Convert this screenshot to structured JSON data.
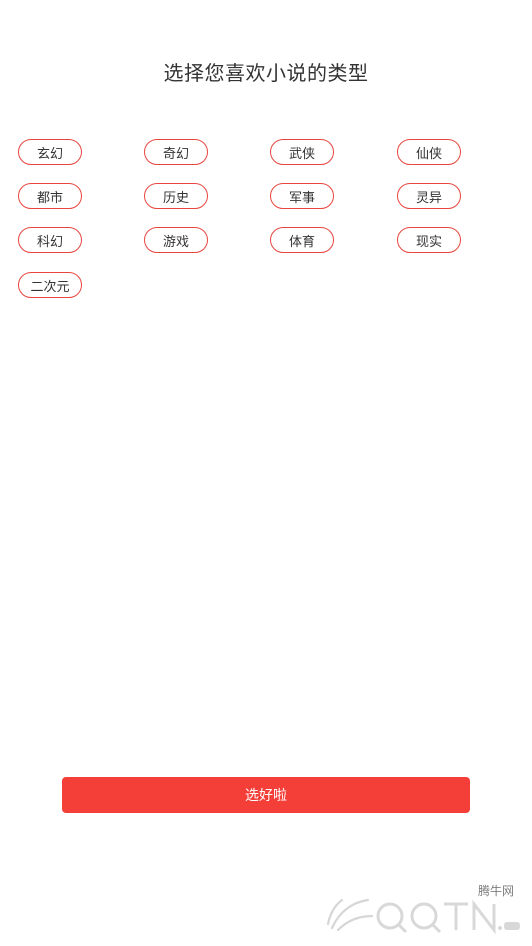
{
  "title": "选择您喜欢小说的类型",
  "genres": [
    "玄幻",
    "奇幻",
    "武侠",
    "仙侠",
    "都市",
    "历史",
    "军事",
    "灵异",
    "科幻",
    "游戏",
    "体育",
    "现实",
    "二次元"
  ],
  "confirm_label": "选好啦",
  "colors": {
    "accent": "#f43f38",
    "chip_border": "#e8463e",
    "text": "#333333"
  },
  "watermark": {
    "cn": "腾牛网",
    "logo_text": "QQTN.com",
    "icon": "watermark-logo-icon"
  }
}
